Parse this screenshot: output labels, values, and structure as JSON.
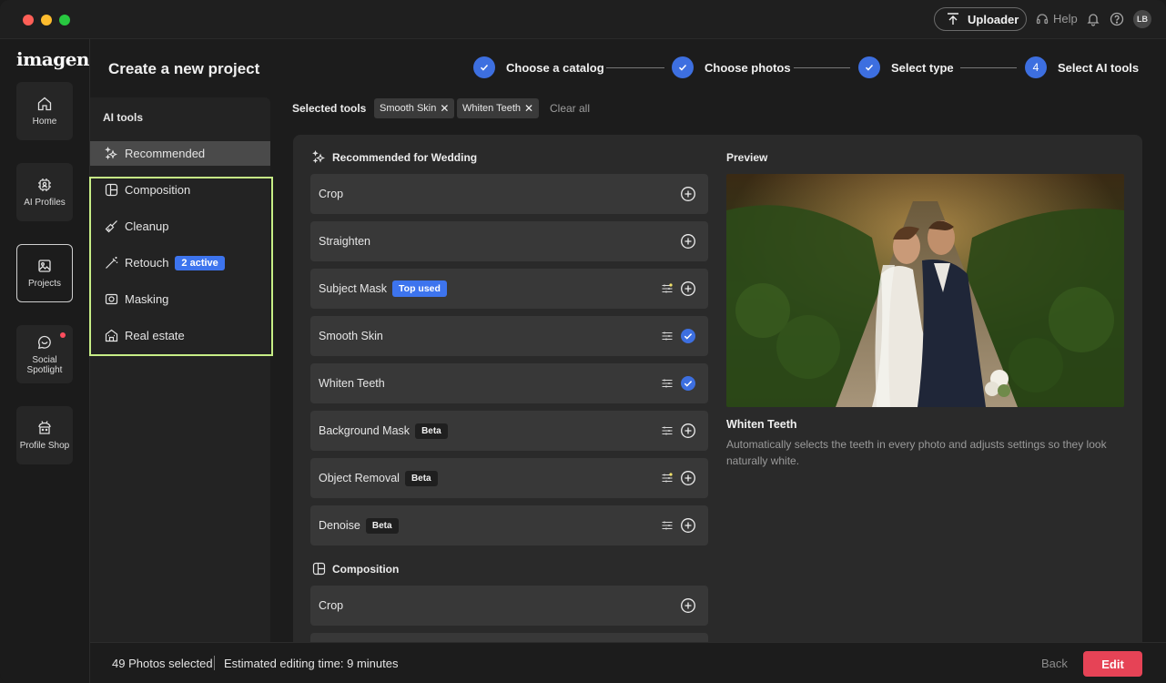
{
  "app": {
    "logo": "imagen"
  },
  "titlebar": {
    "uploader_label": "Uploader",
    "help_label": "Help",
    "avatar_initials": "LB"
  },
  "nav": {
    "items": [
      {
        "label": "Home",
        "icon": "house-icon"
      },
      {
        "label": "AI Profiles",
        "icon": "chip-icon"
      },
      {
        "label": "Projects",
        "icon": "image-icon",
        "active": true
      },
      {
        "label": "Social Spotlight",
        "icon": "chat-icon",
        "dot": true
      },
      {
        "label": "Profile Shop",
        "icon": "shop-icon"
      }
    ]
  },
  "header": {
    "title": "Create a new project",
    "steps": [
      {
        "label": "Choose a catalog",
        "state": "done"
      },
      {
        "label": "Choose photos",
        "state": "done"
      },
      {
        "label": "Select type",
        "state": "done"
      },
      {
        "number": "4",
        "label": "Select AI tools",
        "state": "current"
      }
    ]
  },
  "sidebar": {
    "title": "AI tools",
    "categories": [
      {
        "label": "Recommended",
        "icon": "sparkle-icon",
        "selected": true
      },
      {
        "label": "Composition",
        "icon": "composition-icon"
      },
      {
        "label": "Cleanup",
        "icon": "brush-icon"
      },
      {
        "label": "Retouch",
        "icon": "wand-icon",
        "badge": "2 active"
      },
      {
        "label": "Masking",
        "icon": "mask-icon"
      },
      {
        "label": "Real estate",
        "icon": "building-icon"
      }
    ]
  },
  "selected_tools": {
    "label": "Selected tools",
    "chips": [
      "Smooth Skin",
      "Whiten Teeth"
    ],
    "clear_label": "Clear all"
  },
  "recommended": {
    "title": "Recommended for Wedding",
    "rows": [
      {
        "label": "Crop",
        "state": "add"
      },
      {
        "label": "Straighten",
        "state": "add"
      },
      {
        "label": "Subject Mask",
        "tag": "Top used",
        "tag_style": "blue",
        "tune": true,
        "state": "add"
      },
      {
        "label": "Smooth Skin",
        "tune": true,
        "state": "checked"
      },
      {
        "label": "Whiten Teeth",
        "tune": true,
        "state": "checked"
      },
      {
        "label": "Background Mask",
        "tag": "Beta",
        "tag_style": "dark",
        "tune": true,
        "state": "add"
      },
      {
        "label": "Object Removal",
        "tag": "Beta",
        "tag_style": "dark",
        "tune": true,
        "state": "add"
      },
      {
        "label": "Denoise",
        "tag": "Beta",
        "tag_style": "dark",
        "tune": true,
        "state": "add"
      }
    ]
  },
  "composition": {
    "title": "Composition",
    "rows": [
      {
        "label": "Crop",
        "state": "add"
      }
    ]
  },
  "preview": {
    "title": "Preview",
    "tool_name": "Whiten Teeth",
    "description": "Automatically selects the teeth in every photo and adjusts settings so they look naturally white."
  },
  "footer": {
    "photos_selected": "49 Photos selected",
    "estimated_time": "Estimated editing time: 9 minutes",
    "back_label": "Back",
    "edit_label": "Edit"
  },
  "colors": {
    "accent": "#3d6fe0",
    "edit": "#e64356",
    "highlight": "#c7ee86"
  }
}
